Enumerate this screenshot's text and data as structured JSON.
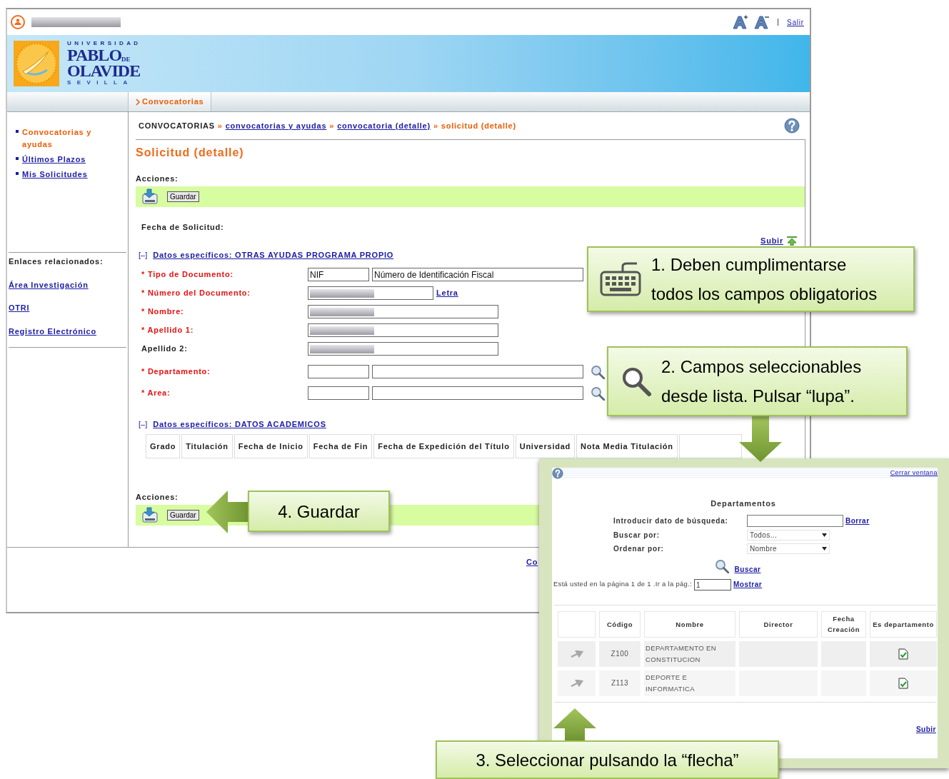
{
  "top_bar": {
    "exit_link": "Salir"
  },
  "logo": {
    "top_line": "UNIVERSIDAD",
    "name_line_1": "PABLO",
    "name_small": "DE",
    "name_line_2": "OLAVIDE",
    "bottom_line": "SEVILLA"
  },
  "nav_tabs": [
    {
      "label": "Convocatorias",
      "selected": true
    }
  ],
  "sidebar": {
    "menu": [
      {
        "label": "Convocatorias y ayudas",
        "selected": true
      },
      {
        "label": "Últimos Plazos",
        "selected": false
      },
      {
        "label": "Mis Solicitudes",
        "selected": false
      }
    ],
    "related_title": "Enlaces relacionados:",
    "related_links": [
      "Área Investigación",
      "OTRI",
      "Registro Electrónico"
    ]
  },
  "breadcrumb": [
    {
      "kind": "root",
      "text": "CONVOCATORIAS"
    },
    {
      "kind": "sep",
      "text": "»"
    },
    {
      "kind": "link",
      "text": "convocatorias y ayudas"
    },
    {
      "kind": "sep",
      "text": "»"
    },
    {
      "kind": "link",
      "text": "convocatoria (detalle)"
    },
    {
      "kind": "sep",
      "text": "»"
    },
    {
      "kind": "current",
      "text": "solicitud (detalle)"
    }
  ],
  "page_title": "Solicitud (detalle)",
  "actions_top": {
    "label": "Acciones:",
    "button": "Guardar"
  },
  "date_label": "Fecha de Solicitud:",
  "top_link": "Subir",
  "sections": [
    {
      "toggle": "[–]",
      "title": "Datos específicos: OTRAS AYUDAS PROGRAMA PROPIO",
      "fields": [
        {
          "label": "* Tipo de Documento:",
          "required": true,
          "kind": "code_desc",
          "code": "NIF",
          "description": "Número de Identificación Fiscal"
        },
        {
          "label": "* Número del Documento:",
          "required": true,
          "kind": "hidden_link",
          "link": "Letra"
        },
        {
          "label": "* Nombre:",
          "required": true,
          "kind": "hidden"
        },
        {
          "label": "* Apellido 1:",
          "required": true,
          "kind": "hidden"
        },
        {
          "label": "Apellido 2:",
          "required": false,
          "kind": "hidden"
        },
        {
          "label": "* Departamento:",
          "required": true,
          "kind": "lookup"
        },
        {
          "label": "* Area:",
          "required": true,
          "kind": "lookup"
        }
      ]
    },
    {
      "toggle": "[–]",
      "title": "Datos específicos: DATOS ACADEMICOS",
      "columns": [
        "Grado",
        "Titulación",
        "Fecha de Inicio",
        "Fecha de Fin",
        "Fecha de Expedición del Título",
        "Universidad",
        "Nota Media Titulación"
      ]
    }
  ],
  "actions_bottom": {
    "label": "Acciones:",
    "button": "Guardar"
  },
  "footer_link": "Co",
  "popup": {
    "close_link": "Cerrar ventana",
    "title": "Departamentos",
    "search_label": "Introducir dato de búsqueda:",
    "clear_link": "Borrar",
    "search_by": {
      "label": "Buscar por:",
      "value": "Todos..."
    },
    "order_by": {
      "label": "Ordenar por:",
      "value": "Nombre"
    },
    "search_link": "Buscar",
    "pager_text": "Está usted en la página 1 de 1 .Ir a la pág.:",
    "page_value": "1",
    "show_link": "Mostrar",
    "columns": [
      "Código",
      "Nombre",
      "Director",
      "Fecha Creación",
      "Es departamento"
    ],
    "rows": [
      {
        "code": "Z100",
        "name": "DEPARTAMENTO EN CONSTITUCION",
        "is_department": true
      },
      {
        "code": "Z113",
        "name": "DEPORTE E INFORMATICA",
        "is_department": true
      }
    ],
    "top_link": "Subir"
  },
  "callouts": [
    {
      "kind": "keyboard",
      "lines": [
        "1. Deben cumplimentarse",
        "todos los campos obligatorios"
      ]
    },
    {
      "kind": "magnifier",
      "lines": [
        "2. Campos seleccionables",
        "desde lista. Pulsar “lupa”."
      ]
    },
    {
      "kind": "upward",
      "lines": [
        "3. Seleccionar pulsando la “flecha”"
      ]
    },
    {
      "kind": "leftward",
      "lines": [
        "4. Guardar"
      ]
    }
  ]
}
